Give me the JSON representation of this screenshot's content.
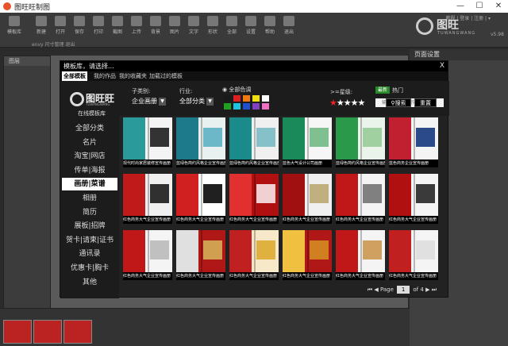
{
  "window": {
    "title": "图旺旺制图",
    "minimize": "—",
    "maximize": "☐",
    "close": "✕"
  },
  "toolbar": {
    "top_links": "教程 | 登录 | 注册 | ▾",
    "tools": [
      "模板库",
      "新建",
      "打开",
      "保存",
      "打印",
      "截图",
      "上传",
      "背景",
      "图片",
      "文字",
      "形状",
      "全部",
      "设置",
      "帮助",
      "退出"
    ],
    "brand_name": "图旺",
    "brand_sub": "TUWANGWANG",
    "version": "v5.98",
    "sub_left": "envy  尺寸管理  退出"
  },
  "panels": {
    "layers_title": "图层",
    "page_settings_title": "页面设置"
  },
  "modal": {
    "title": "模板库，请选择...",
    "close": "X",
    "tabs": [
      "全部模板",
      "我的作品",
      "我的收藏夹",
      "加载过的模板"
    ],
    "logo_name": "图旺旺",
    "logo_sub": "TUWANGWANG",
    "logo_caption": "在线模板库",
    "categories": [
      "全部分类",
      "名片",
      "淘宝|网店",
      "传单|海报",
      "画册|菜谱",
      "相册",
      "简历",
      "展板|招牌",
      "贺卡|请柬|证书",
      "通讯录",
      "优惠卡|胸卡",
      "其他"
    ],
    "active_category_index": 4,
    "filters": {
      "subcategory_label": "子类别:",
      "subcategory_value": "企业画册",
      "industry_label": "行业:",
      "industry_value": "全部分类",
      "color_label": "全部色调",
      "star_label": ">=星级:",
      "star_rating": 1,
      "new_label": "最新",
      "hot_label": "热门",
      "search_placeholder": "输入关键词或作品ID",
      "search_button": "搜索",
      "reset_button": "重置"
    },
    "color_swatches": [
      "#1a1a1a",
      "#e02020",
      "#f07a10",
      "#f0e010",
      "#ffffff",
      "#20a020",
      "#20c0e0",
      "#2050d0",
      "#8040c0",
      "#f070c0"
    ],
    "templates": [
      {
        "caption": "现代时尚家居装修宣传画册",
        "palette": [
          "#f4f4f4",
          "#2a9a9a",
          "#333333"
        ]
      },
      {
        "caption": "蓝绿色简约风格企业宣传画册",
        "palette": [
          "#e8f0f0",
          "#1d7a8a",
          "#6cb8c8"
        ]
      },
      {
        "caption": "蓝绿色简约风格企业宣传画册",
        "palette": [
          "#f0f0f0",
          "#1a8a8a",
          "#86c0c8"
        ]
      },
      {
        "caption": "蓝色大气设计公司画册",
        "palette": [
          "#f6f6f6",
          "#1a8a5a",
          "#80c090"
        ]
      },
      {
        "caption": "蓝绿色简约风格企业宣传画册",
        "palette": [
          "#eaf4ea",
          "#2a9a4a",
          "#a0d0a0"
        ]
      },
      {
        "caption": "蓝色商务企业宣传画册",
        "palette": [
          "#f4f4f4",
          "#c02030",
          "#2a4a8a"
        ]
      },
      {
        "caption": "红色商务大气企业宣传画册",
        "palette": [
          "#f0f0f0",
          "#c01a1a",
          "#303030"
        ]
      },
      {
        "caption": "红色商务大气企业宣传画册",
        "palette": [
          "#ffffff",
          "#d02020",
          "#202020"
        ]
      },
      {
        "caption": "红色商务大气企业宣传画册",
        "palette": [
          "#b01010",
          "#e03030",
          "#f0d0d0"
        ]
      },
      {
        "caption": "红色商务大气企业宣传画册",
        "palette": [
          "#f0f0f0",
          "#a01010",
          "#c0b080"
        ]
      },
      {
        "caption": "红色商务大气企业宣传画册",
        "palette": [
          "#f4f4f4",
          "#c01818",
          "#808080"
        ]
      },
      {
        "caption": "红色商务大气企业宣传画册",
        "palette": [
          "#f4f4f4",
          "#b01010",
          "#3a3a3a"
        ]
      },
      {
        "caption": "红色商务大气企业宣传画册",
        "palette": [
          "#f4f4f4",
          "#c01818",
          "#c0c0c0"
        ]
      },
      {
        "caption": "红色商务大气企业宣传画册",
        "palette": [
          "#b01818",
          "#e0e0e0",
          "#d0a050"
        ]
      },
      {
        "caption": "红色商务大气企业宣传画册",
        "palette": [
          "#f6e8c8",
          "#c02020",
          "#e0b040"
        ]
      },
      {
        "caption": "红色商务大气企业宣传画册",
        "palette": [
          "#b01818",
          "#f0c040",
          "#d08020"
        ]
      },
      {
        "caption": "红色商务大气企业宣传画册",
        "palette": [
          "#f4f4f4",
          "#c01818",
          "#d0a060"
        ]
      },
      {
        "caption": "红色商务大气企业宣传画册",
        "palette": [
          "#f4f4f4",
          "#c02020",
          "#e0e0e0"
        ]
      }
    ],
    "pager": {
      "first": "⏮",
      "prev": "◀",
      "page_label": "Page",
      "current_page": "1",
      "of_label": "of",
      "total_pages": "4",
      "next": "▶",
      "last": "⏭"
    }
  }
}
